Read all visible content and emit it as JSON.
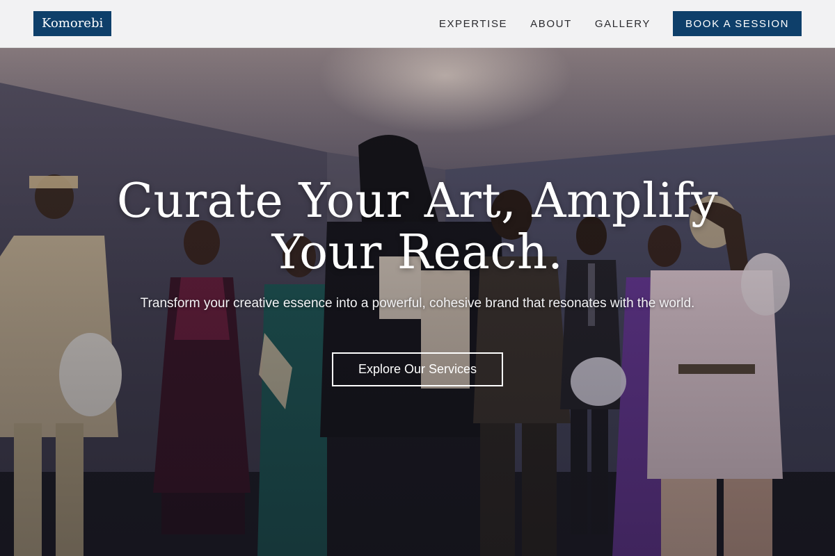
{
  "header": {
    "logo_text": "Komorebi",
    "nav": [
      {
        "label": "EXPERTISE"
      },
      {
        "label": "ABOUT"
      },
      {
        "label": "GALLERY"
      }
    ],
    "cta_label": "BOOK A SESSION"
  },
  "hero": {
    "title_line1": "Curate Your Art, Amplify",
    "title_line2": "Your Reach.",
    "subtitle": "Transform your creative essence into a powerful, cohesive brand that resonates with the world.",
    "button_label": "Explore Our Services"
  },
  "colors": {
    "brand_navy": "#0e3f6a",
    "header_bg": "#f2f2f3",
    "hero_text": "#ffffff"
  },
  "icons": {
    "hero_image": "fashion-group-photo"
  }
}
